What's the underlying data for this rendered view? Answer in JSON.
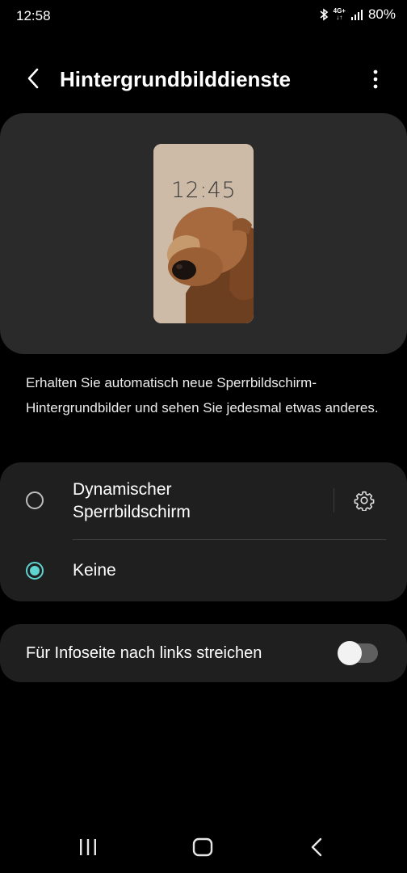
{
  "status_bar": {
    "time": "12:58",
    "network_top": "4G+",
    "battery": "80%",
    "icons": [
      "bluetooth-icon",
      "data-arrows-icon",
      "signal-icon",
      "battery-icon"
    ]
  },
  "header": {
    "title": "Hintergrundbilddienste",
    "back_icon": "back-chevron-icon",
    "more_icon": "more-vertical-icon"
  },
  "preview": {
    "clock": "12:45",
    "image": "dog-wallpaper"
  },
  "description": "Erhalten Sie automatisch neue Sperrbildschirm-Hintergrundbilder und sehen Sie jedesmal etwas anderes.",
  "options": [
    {
      "label_line1": "Dynamischer",
      "label_line2": "Sperrbildschirm",
      "selected": false,
      "settings_icon": "gear-icon"
    },
    {
      "label": "Keine",
      "selected": true
    }
  ],
  "swipe_setting": {
    "label": "Für Infoseite nach links streichen",
    "enabled": false
  },
  "nav_bar": {
    "icons": [
      "recents-icon",
      "home-icon",
      "back-icon"
    ]
  },
  "colors": {
    "background": "#000000",
    "card": "#1f1f1f",
    "preview_card": "#2a2a2a",
    "accent": "#5fd3d0"
  }
}
